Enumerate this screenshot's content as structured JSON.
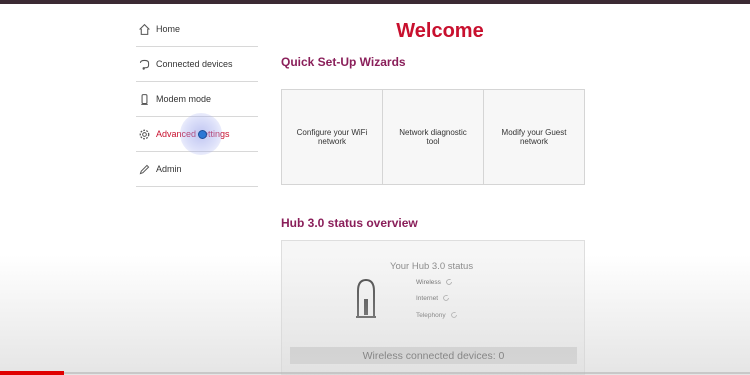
{
  "sidebar": {
    "items": [
      {
        "label": "Home",
        "icon": "home-icon"
      },
      {
        "label": "Connected devices",
        "icon": "plug-icon"
      },
      {
        "label": "Modem mode",
        "icon": "modem-icon"
      },
      {
        "label": "Advanced settings",
        "icon": "gear-icon",
        "active": true
      },
      {
        "label": "Admin",
        "icon": "pencil-icon"
      }
    ]
  },
  "main": {
    "title": "Welcome",
    "wizards_title": "Quick Set-Up Wizards",
    "wizards": [
      {
        "label": "Configure your WiFi network"
      },
      {
        "label": "Network diagnostic tool"
      },
      {
        "label": "Modify your Guest network"
      }
    ],
    "status_title": "Hub 3.0 status overview",
    "status": {
      "heading": "Your Hub 3.0 status",
      "rows": [
        {
          "label": "Wireless"
        },
        {
          "label": "Internet"
        },
        {
          "label": "Telephony"
        }
      ],
      "connected_label": "Wireless connected devices: 0"
    }
  },
  "video": {
    "progress_fraction": 0.085
  },
  "colors": {
    "accent_red": "#c8102e",
    "section_purple": "#8a1f5a"
  }
}
